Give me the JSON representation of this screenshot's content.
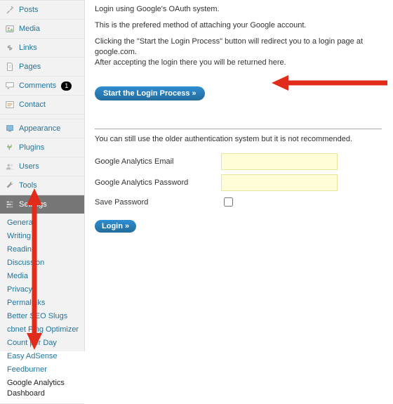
{
  "sidebar": {
    "posts": "Posts",
    "media": "Media",
    "links": "Links",
    "pages": "Pages",
    "comments": "Comments",
    "comment_count": "1",
    "contact": "Contact",
    "appearance": "Appearance",
    "plugins": "Plugins",
    "users": "Users",
    "tools": "Tools",
    "settings": "Settings",
    "sub": [
      "General",
      "Writing",
      "Reading",
      "Discussion",
      "Media",
      "Privacy",
      "Permalinks",
      "Better SEO Slugs",
      "cbnet Ping Optimizer",
      "Count per Day",
      "Easy AdSense",
      "Feedburner",
      "Google Analytics Dashboard"
    ]
  },
  "main": {
    "oauth_heading": "Login using Google's OAuth system.",
    "oauth_p1": "This is the prefered method of attaching your Google account.",
    "oauth_p2": "Clicking the \"Start the Login Process\" button will redirect you to a login page at google.com.",
    "oauth_p3": "After accepting the login there you will be returned here.",
    "start_button": "Start the Login Process »",
    "old_hint": "You can still use the older authentication system but it is not recommended.",
    "label_email": "Google Analytics Email",
    "label_password": "Google Analytics Password",
    "label_save": "Save Password",
    "login_button": "Login »"
  },
  "colors": {
    "accent": "#2e8dd1",
    "link": "#21759b",
    "arrow": "#e22c1b",
    "input_bg": "#fefdd7"
  }
}
